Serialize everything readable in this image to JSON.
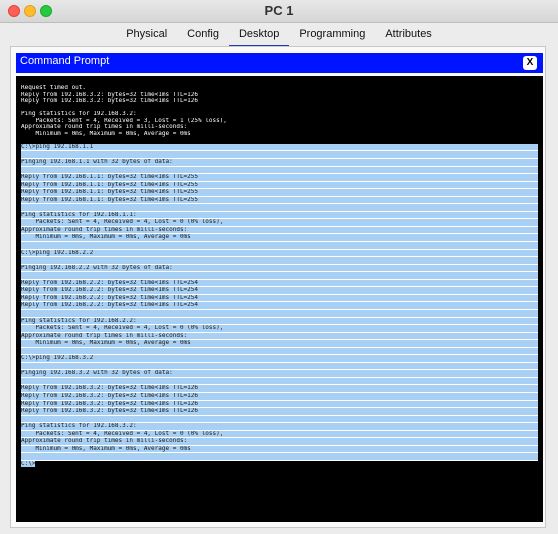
{
  "window": {
    "title": "PC 1"
  },
  "tabs": [
    {
      "label": "Physical"
    },
    {
      "label": "Config"
    },
    {
      "label": "Desktop"
    },
    {
      "label": "Programming"
    },
    {
      "label": "Attributes"
    }
  ],
  "cmd": {
    "title": "Command Prompt",
    "close_label": "X"
  },
  "console": {
    "lines": [
      {
        "text": "Request timed out.",
        "sel": false
      },
      {
        "text": "Reply from 192.168.3.2: bytes=32 time<1ms TTL=126",
        "sel": false
      },
      {
        "text": "Reply from 192.168.3.2: bytes=32 time<1ms TTL=126",
        "sel": false
      },
      {
        "text": "",
        "sel": false
      },
      {
        "text": "Ping statistics for 192.168.3.2:",
        "sel": false
      },
      {
        "text": "    Packets: Sent = 4, Received = 3, Lost = 1 (25% loss),",
        "sel": false
      },
      {
        "text": "Approximate round trip times in milli-seconds:",
        "sel": false
      },
      {
        "text": "    Minimum = 0ms, Maximum = 0ms, Average = 0ms",
        "sel": false
      },
      {
        "text": "",
        "sel": false
      },
      {
        "text": "C:\\>ping 192.168.1.1",
        "sel": true
      },
      {
        "text": "",
        "sel": true
      },
      {
        "text": "Pinging 192.168.1.1 with 32 bytes of data:",
        "sel": true
      },
      {
        "text": "",
        "sel": true
      },
      {
        "text": "Reply from 192.168.1.1: bytes=32 time<1ms TTL=255",
        "sel": true
      },
      {
        "text": "Reply from 192.168.1.1: bytes=32 time<1ms TTL=255",
        "sel": true
      },
      {
        "text": "Reply from 192.168.1.1: bytes=32 time<1ms TTL=255",
        "sel": true
      },
      {
        "text": "Reply from 192.168.1.1: bytes=32 time<1ms TTL=255",
        "sel": true
      },
      {
        "text": "",
        "sel": true
      },
      {
        "text": "Ping statistics for 192.168.1.1:",
        "sel": true
      },
      {
        "text": "    Packets: Sent = 4, Received = 4, Lost = 0 (0% loss),",
        "sel": true
      },
      {
        "text": "Approximate round trip times in milli-seconds:",
        "sel": true
      },
      {
        "text": "    Minimum = 0ms, Maximum = 0ms, Average = 0ms",
        "sel": true
      },
      {
        "text": "",
        "sel": true
      },
      {
        "text": "C:\\>ping 192.168.2.2",
        "sel": true
      },
      {
        "text": "",
        "sel": true
      },
      {
        "text": "Pinging 192.168.2.2 with 32 bytes of data:",
        "sel": true
      },
      {
        "text": "",
        "sel": true
      },
      {
        "text": "Reply from 192.168.2.2: bytes=32 time<1ms TTL=254",
        "sel": true
      },
      {
        "text": "Reply from 192.168.2.2: bytes=32 time<1ms TTL=254",
        "sel": true
      },
      {
        "text": "Reply from 192.168.2.2: bytes=32 time<1ms TTL=254",
        "sel": true
      },
      {
        "text": "Reply from 192.168.2.2: bytes=32 time<1ms TTL=254",
        "sel": true
      },
      {
        "text": "",
        "sel": true
      },
      {
        "text": "Ping statistics for 192.168.2.2:",
        "sel": true
      },
      {
        "text": "    Packets: Sent = 4, Received = 4, Lost = 0 (0% loss),",
        "sel": true
      },
      {
        "text": "Approximate round trip times in milli-seconds:",
        "sel": true
      },
      {
        "text": "    Minimum = 0ms, Maximum = 0ms, Average = 0ms",
        "sel": true
      },
      {
        "text": "",
        "sel": true
      },
      {
        "text": "C:\\>ping 192.168.3.2",
        "sel": true
      },
      {
        "text": "",
        "sel": true
      },
      {
        "text": "Pinging 192.168.3.2 with 32 bytes of data:",
        "sel": true
      },
      {
        "text": "",
        "sel": true
      },
      {
        "text": "Reply from 192.168.3.2: bytes=32 time<1ms TTL=126",
        "sel": true
      },
      {
        "text": "Reply from 192.168.3.2: bytes=32 time<1ms TTL=126",
        "sel": true
      },
      {
        "text": "Reply from 192.168.3.2: bytes=32 time<1ms TTL=126",
        "sel": true
      },
      {
        "text": "Reply from 192.168.3.2: bytes=32 time<1ms TTL=126",
        "sel": true
      },
      {
        "text": "",
        "sel": true
      },
      {
        "text": "Ping statistics for 192.168.3.2:",
        "sel": true
      },
      {
        "text": "    Packets: Sent = 4, Received = 4, Lost = 0 (0% loss),",
        "sel": true
      },
      {
        "text": "Approximate round trip times in milli-seconds:",
        "sel": true
      },
      {
        "text": "    Minimum = 0ms, Maximum = 0ms, Average = 0ms",
        "sel": true
      },
      {
        "text": "",
        "sel": true
      }
    ],
    "prompt": "C:\\>"
  }
}
